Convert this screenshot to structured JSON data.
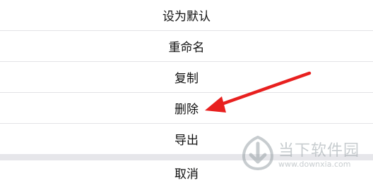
{
  "menu": {
    "items": [
      {
        "label": "设为默认"
      },
      {
        "label": "重命名"
      },
      {
        "label": "复制"
      },
      {
        "label": "删除"
      },
      {
        "label": "导出"
      }
    ],
    "cancel_label": "取消"
  },
  "annotation": {
    "arrow_color": "#e8201f",
    "arrow_target": "删除"
  },
  "watermark": {
    "brand": "当下软件园",
    "url": "www.downxia.com",
    "icon": "downxia-logo-icon"
  }
}
